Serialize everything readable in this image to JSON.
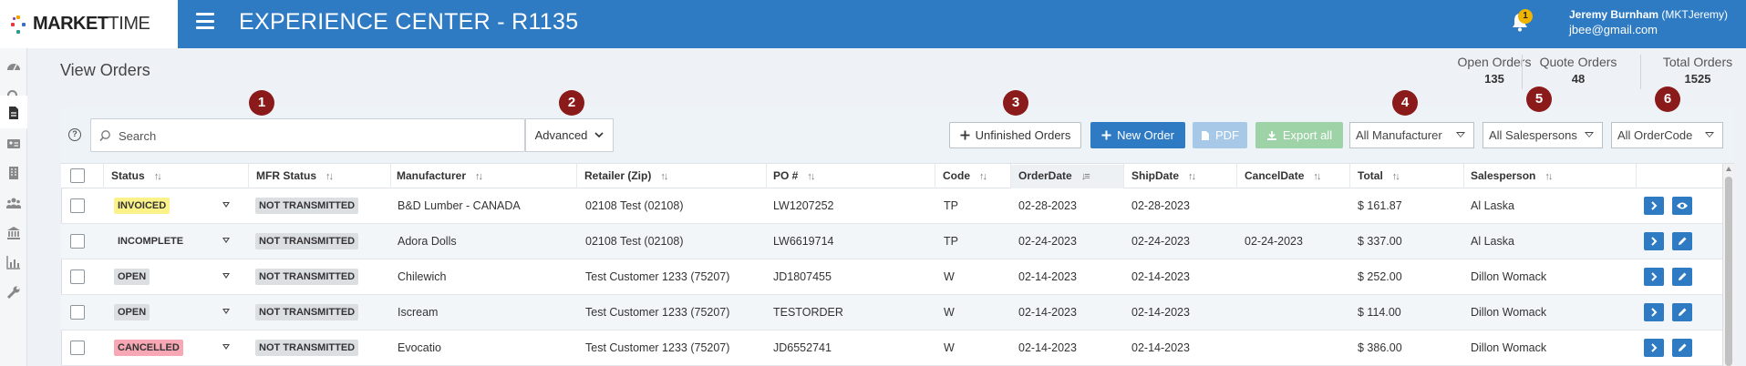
{
  "app": {
    "logo_bold": "MARKET",
    "logo_light": "TIME",
    "title": "EXPERIENCE CENTER - R1135",
    "notification_count": "1",
    "user_name": "Jeremy Burnham",
    "user_handle": "(MKTJeremy)",
    "user_email": "jbee@gmail.com"
  },
  "page": {
    "title": "View Orders",
    "stats": [
      {
        "label": "Open Orders",
        "value": "135"
      },
      {
        "label": "Quote Orders",
        "value": "48"
      },
      {
        "label": "Total Orders",
        "value": "1525"
      }
    ]
  },
  "toolbar": {
    "help_glyph": "?",
    "search_placeholder": "Search",
    "advanced_label": "Advanced",
    "unfinished_label": "Unfinished Orders",
    "new_order_label": "New Order",
    "pdf_label": "PDF",
    "export_label": "Export all",
    "manufacturer_select": "All Manufacturer",
    "salespersons_select": "All Salespersons",
    "ordercode_select": "All OrderCode",
    "markers": [
      "1",
      "2",
      "3",
      "4",
      "5",
      "6"
    ]
  },
  "table": {
    "columns": [
      "Status",
      "MFR Status",
      "Manufacturer",
      "Retailer (Zip)",
      "PO #",
      "Code",
      "OrderDate",
      "ShipDate",
      "CancelDate",
      "Total",
      "Salesperson"
    ],
    "rows": [
      {
        "status": "INVOICED",
        "status_color": "#fbf28a",
        "mfr_status": "NOT TRANSMITTED",
        "manufacturer": "B&D Lumber - CANADA",
        "retailer": "02108 Test (02108)",
        "po": "LW1207252",
        "code": "TP",
        "order_date": "02-28-2023",
        "ship_date": "02-28-2023",
        "cancel_date": "",
        "total": "$ 161.87",
        "salesperson": "Al Laska",
        "second_action": "eye-icon"
      },
      {
        "status": "INCOMPLETE",
        "status_color": "",
        "mfr_status": "NOT TRANSMITTED",
        "manufacturer": "Adora Dolls",
        "retailer": "02108 Test (02108)",
        "po": "LW6619714",
        "code": "TP",
        "order_date": "02-24-2023",
        "ship_date": "02-24-2023",
        "cancel_date": "02-24-2023",
        "total": "$ 337.00",
        "salesperson": "Al Laska",
        "second_action": "pencil-icon"
      },
      {
        "status": "OPEN",
        "status_color": "#dcdfe2",
        "mfr_status": "NOT TRANSMITTED",
        "manufacturer": "Chilewich",
        "retailer": "Test Customer 1233 (75207)",
        "po": "JD1807455",
        "code": "W",
        "order_date": "02-14-2023",
        "ship_date": "02-14-2023",
        "cancel_date": "",
        "total": "$ 252.00",
        "salesperson": "Dillon Womack",
        "second_action": "pencil-icon"
      },
      {
        "status": "OPEN",
        "status_color": "#dcdfe2",
        "mfr_status": "NOT TRANSMITTED",
        "manufacturer": "Iscream",
        "retailer": "Test Customer 1233 (75207)",
        "po": "TESTORDER",
        "code": "W",
        "order_date": "02-14-2023",
        "ship_date": "02-14-2023",
        "cancel_date": "",
        "total": "$ 114.00",
        "salesperson": "Dillon Womack",
        "second_action": "pencil-icon"
      },
      {
        "status": "CANCELLED",
        "status_color": "#f7a8b4",
        "mfr_status": "NOT TRANSMITTED",
        "manufacturer": "Evocatio",
        "retailer": "Test Customer 1233 (75207)",
        "po": "JD6552741",
        "code": "W",
        "order_date": "02-14-2023",
        "ship_date": "02-14-2023",
        "cancel_date": "",
        "total": "$ 386.00",
        "salesperson": "Dillon Womack",
        "second_action": "pencil-icon"
      }
    ]
  },
  "colors": {
    "brand_blue": "#2e7bc4",
    "marker_red": "#8b1a1a"
  }
}
